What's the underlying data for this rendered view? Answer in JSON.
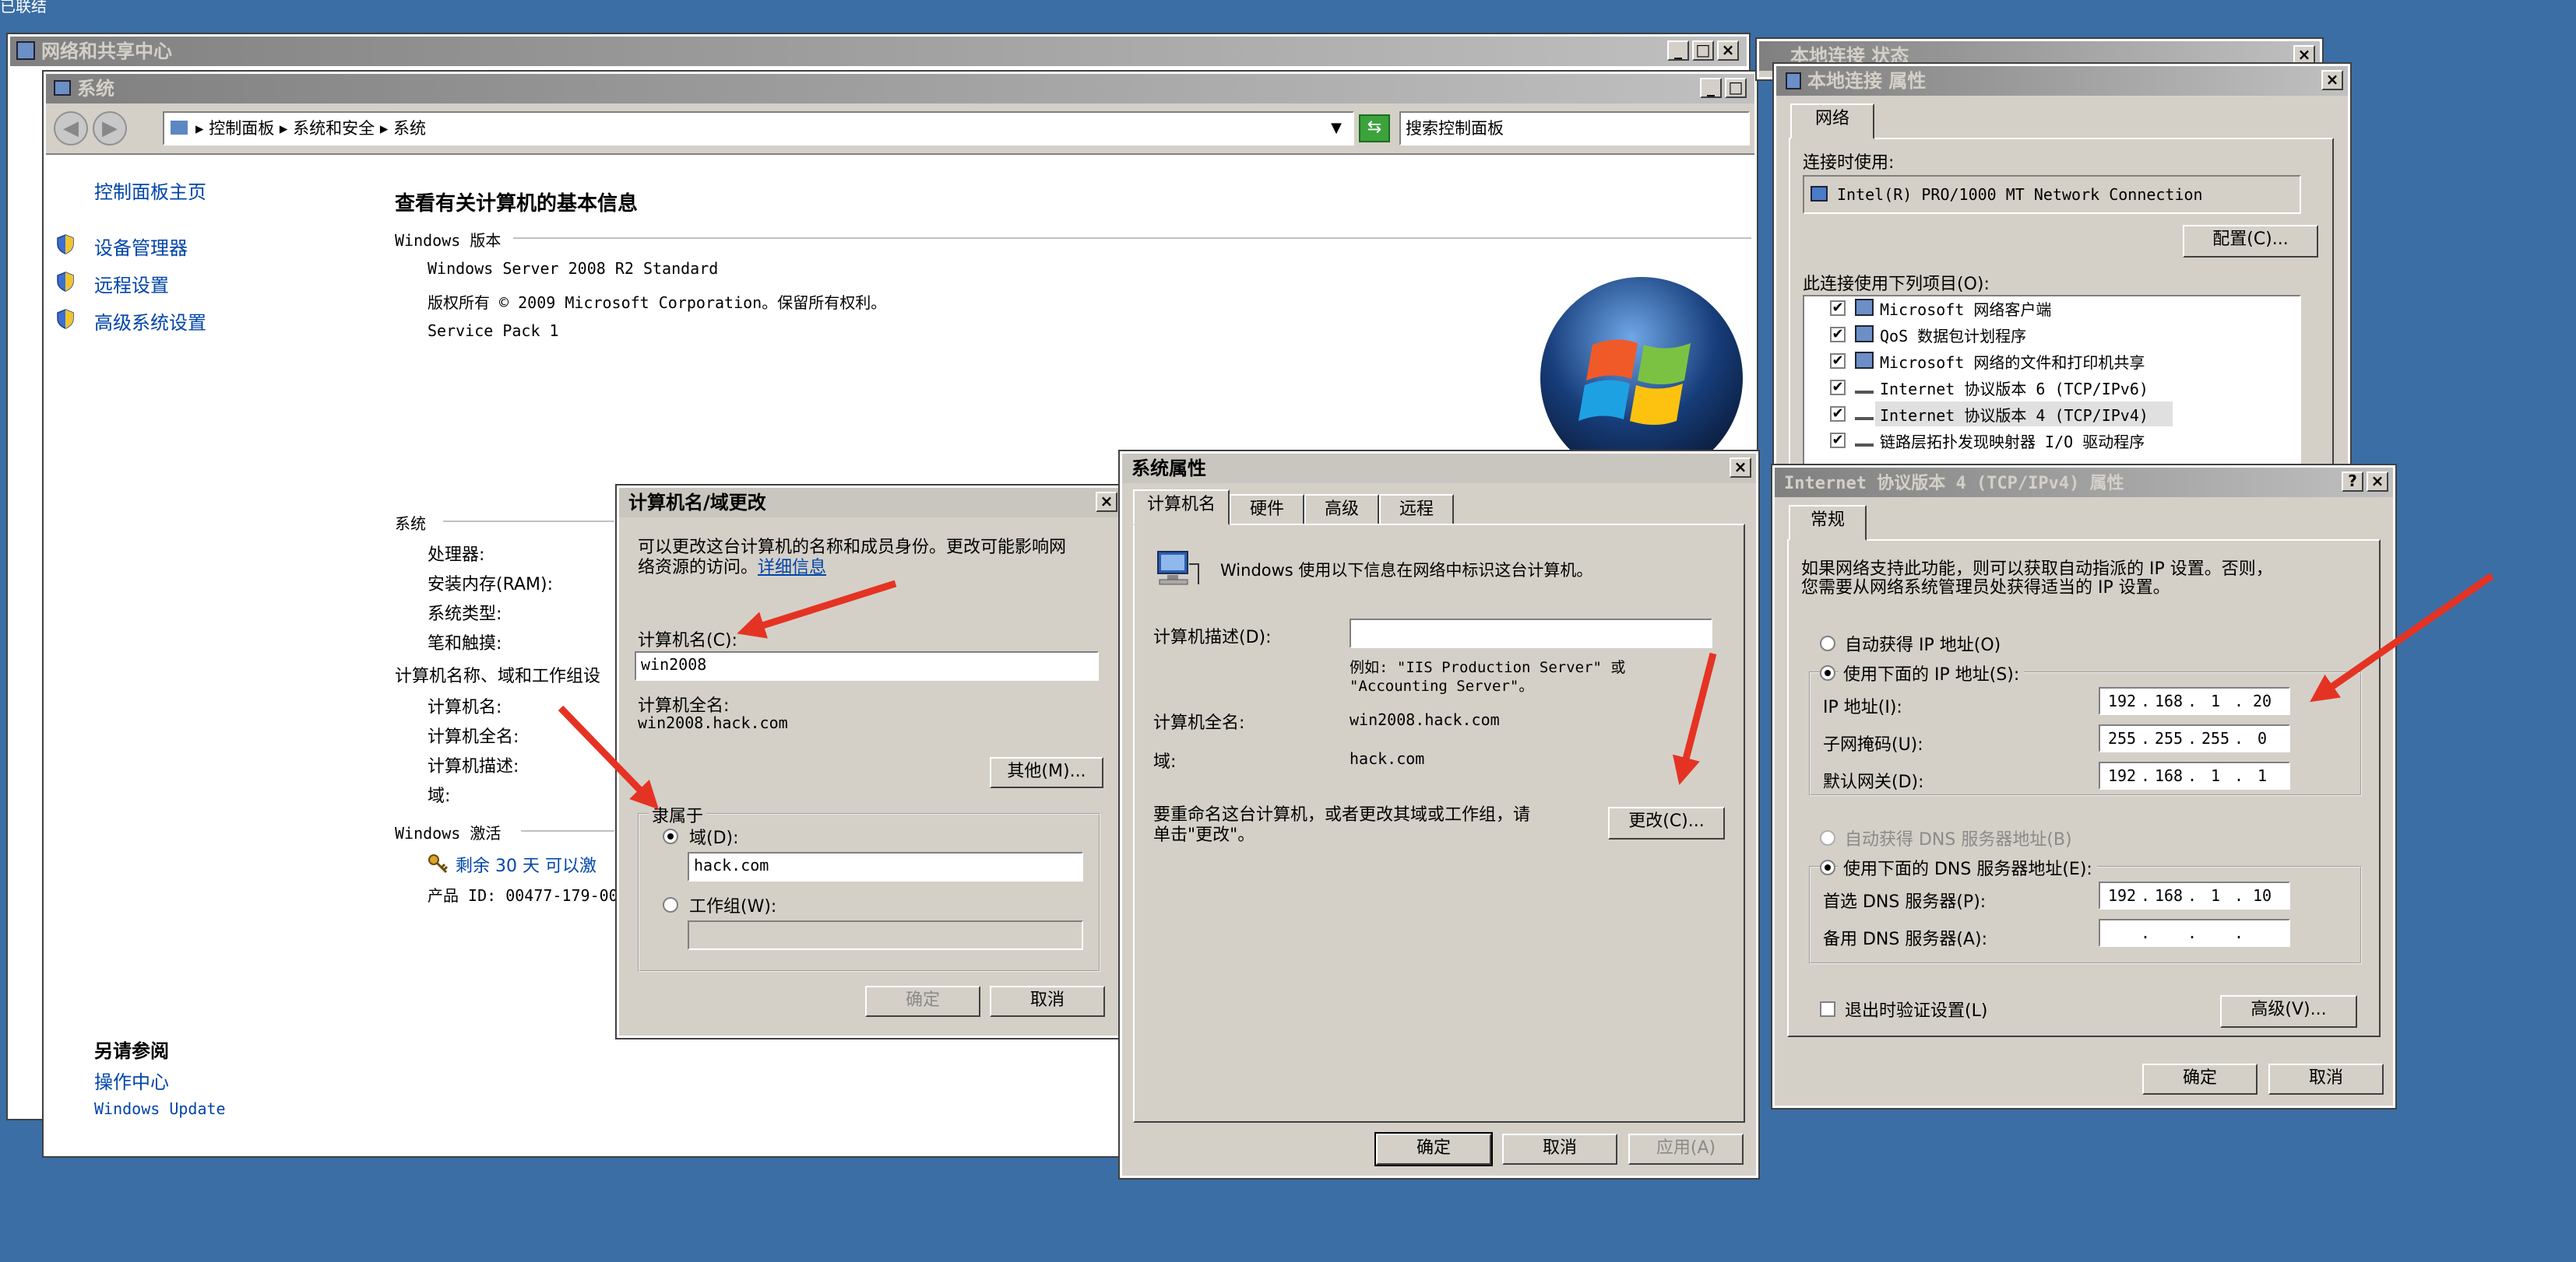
{
  "top_label": "已联结",
  "network_window": {
    "title": "网络和共享中心"
  },
  "system_window": {
    "title": "系统",
    "breadcrumb": [
      "控制面板",
      "系统和安全",
      "系统"
    ],
    "search_placeholder": "搜索控制面板",
    "sidebar": {
      "home": "控制面板主页",
      "items": [
        "设备管理器",
        "远程设置",
        "高级系统设置"
      ],
      "see_also_heading": "另请参阅",
      "see_also": [
        "操作中心",
        "Windows Update"
      ]
    },
    "main": {
      "heading": "查看有关计算机的基本信息",
      "edition_section": "Windows 版本",
      "edition": "Windows Server 2008 R2 Standard",
      "copyright": "版权所有 © 2009 Microsoft Corporation。保留所有权利。",
      "service_pack": "Service Pack 1",
      "system_section": "系统",
      "system_fields": [
        "处理器:",
        "安装内存(RAM):",
        "系统类型:",
        "笔和触摸:"
      ],
      "computer_section": "计算机名称、域和工作组设",
      "computer_fields": [
        "计算机名:",
        "计算机全名:",
        "计算机描述:",
        "域:"
      ],
      "activation_section": "Windows 激活",
      "activation_text": "剩余 30 天 可以激",
      "product_id": "产品 ID: 00477-179-00"
    }
  },
  "rename_dialog": {
    "title": "计算机名/域更改",
    "description_line1": "可以更改这台计算机的名称和成员身份。更改可能影响网",
    "description_line2": "络资源的访问。",
    "details_link": "详细信息",
    "computer_name_label": "计算机名(C):",
    "computer_name_value": "win2008",
    "full_name_label": "计算机全名:",
    "full_name_value": "win2008.hack.com",
    "more_button": "其他(M)...",
    "member_of_label": "隶属于",
    "domain_label": "域(D):",
    "domain_value": "hack.com",
    "workgroup_label": "工作组(W):",
    "workgroup_value": "",
    "ok_button": "确定",
    "cancel_button": "取消"
  },
  "sysprops_dialog": {
    "title": "系统属性",
    "tabs": [
      "计算机名",
      "硬件",
      "高级",
      "远程"
    ],
    "info_text": "Windows 使用以下信息在网络中标识这台计算机。",
    "desc_label": "计算机描述(D):",
    "desc_value": "",
    "example_line1": "例如: \"IIS Production Server\" 或",
    "example_line2": "\"Accounting Server\"。",
    "full_name_label": "计算机全名:",
    "full_name_value": "win2008.hack.com",
    "domain_label": "域:",
    "domain_value": "hack.com",
    "rename_text_line1": "要重命名这台计算机，或者更改其域或工作组，请",
    "rename_text_line2": "单击\"更改\"。",
    "change_button": "更改(C)...",
    "ok_button": "确定",
    "cancel_button": "取消",
    "apply_button": "应用(A)"
  },
  "local_status_window": {
    "title": "本地连接 状态"
  },
  "local_props_dialog": {
    "title": "本地连接 属性",
    "tab": "网络",
    "connect_using_label": "连接时使用:",
    "adapter": "Intel(R) PRO/1000 MT Network Connection",
    "configure_button": "配置(C)...",
    "items_label": "此连接使用下列项目(O):",
    "items": [
      "Microsoft 网络客户端",
      "QoS 数据包计划程序",
      "Microsoft 网络的文件和打印机共享",
      "Internet 协议版本 6 (TCP/IPv6)",
      "Internet 协议版本 4 (TCP/IPv4)",
      "链路层拓扑发现映射器 I/O 驱动程序"
    ]
  },
  "ipv4_dialog": {
    "title": "Internet 协议版本 4 (TCP/IPv4) 属性",
    "help_button": "?",
    "tab": "常规",
    "intro_line1": "如果网络支持此功能，则可以获取自动指派的 IP 设置。否则，",
    "intro_line2": "您需要从网络系统管理员处获得适当的 IP 设置。",
    "auto_ip_label": "自动获得 IP 地址(O)",
    "manual_ip_label": "使用下面的 IP 地址(S):",
    "ip_label": "IP 地址(I):",
    "ip_value": [
      "192",
      "168",
      "1",
      "20"
    ],
    "mask_label": "子网掩码(U):",
    "mask_value": [
      "255",
      "255",
      "255",
      "0"
    ],
    "gateway_label": "默认网关(D):",
    "gateway_value": [
      "192",
      "168",
      "1",
      "1"
    ],
    "auto_dns_label": "自动获得 DNS 服务器地址(B)",
    "manual_dns_label": "使用下面的 DNS 服务器地址(E):",
    "preferred_dns_label": "首选 DNS 服务器(P):",
    "preferred_dns_value": [
      "192",
      "168",
      "1",
      "10"
    ],
    "alternate_dns_label": "备用 DNS 服务器(A):",
    "alternate_dns_value": [
      "",
      "",
      "",
      ""
    ],
    "validate_label": "退出时验证设置(L)",
    "advanced_button": "高级(V)...",
    "ok_button": "确定",
    "cancel_button": "取消"
  },
  "colors": {
    "desktop": "#3a6ea5",
    "dialog": "#d4d0c8",
    "title_active": "#0a246a",
    "arrow": "#e53323",
    "link": "#0044aa"
  }
}
